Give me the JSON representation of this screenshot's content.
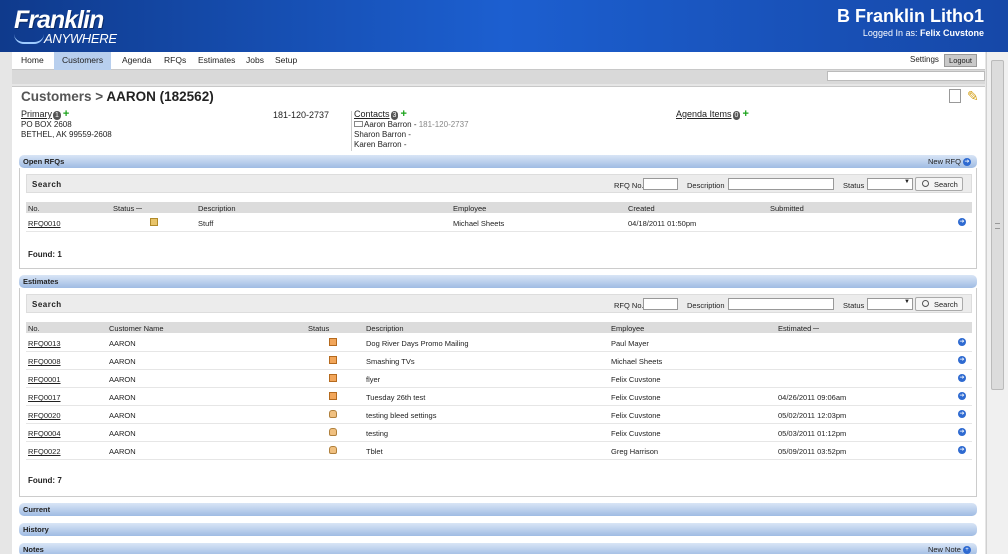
{
  "header": {
    "logo_main": "Franklin",
    "logo_sub": "ANYWHERE",
    "company": "B Franklin Litho1",
    "logged_prefix": "Logged In as:",
    "logged_user": "Felix Cuvstone"
  },
  "nav": {
    "items": [
      "Home",
      "Customers",
      "Agenda",
      "RFQs",
      "Estimates",
      "Jobs",
      "Setup"
    ],
    "settings": "Settings",
    "logout": "Logout"
  },
  "page": {
    "title_prefix": "Customers >",
    "title_name": "AARON (182562)"
  },
  "primary": {
    "label": "Primary",
    "count": "1",
    "address1": "PO BOX 2608",
    "address2": "BETHEL, AK 99559-2608",
    "phone": "181-120-2737"
  },
  "contacts": {
    "label": "Contacts",
    "count": "3",
    "items": [
      {
        "name": "Aaron Barron",
        "sep": " - ",
        "phone": "181-120-2737"
      },
      {
        "name": "Sharon Barron",
        "sep": " -",
        "phone": ""
      },
      {
        "name": "Karen Barron",
        "sep": " -",
        "phone": ""
      }
    ]
  },
  "agenda": {
    "label": "Agenda Items",
    "count": "0"
  },
  "open_rfqs": {
    "title": "Open RFQs",
    "new_link": "New RFQ",
    "search": {
      "label": "Search",
      "rfq_no_label": "RFQ No.",
      "desc_label": "Description",
      "status_label": "Status",
      "button": "Search"
    },
    "columns": [
      "No.",
      "Status",
      "Description",
      "Employee",
      "Created",
      "Submitted"
    ],
    "rows": [
      {
        "no": "RFQ0010",
        "status": "folder",
        "description": "Stuff",
        "employee": "Michael Sheets",
        "created": "04/18/2011 01:50pm",
        "submitted": ""
      }
    ],
    "found": "Found: 1"
  },
  "estimates": {
    "title": "Estimates",
    "search": {
      "label": "Search",
      "rfq_no_label": "RFQ No.",
      "desc_label": "Description",
      "status_label": "Status",
      "button": "Search"
    },
    "columns": [
      "No.",
      "Customer Name",
      "Status",
      "Description",
      "Employee",
      "Estimated"
    ],
    "rows": [
      {
        "no": "RFQ0013",
        "customer": "AARON",
        "status": "doc",
        "description": "Dog River Days Promo Mailing",
        "employee": "Paul Mayer",
        "estimated": ""
      },
      {
        "no": "RFQ0008",
        "customer": "AARON",
        "status": "doc",
        "description": "Smashing TVs",
        "employee": "Michael Sheets",
        "estimated": ""
      },
      {
        "no": "RFQ0001",
        "customer": "AARON",
        "status": "doc",
        "description": "flyer",
        "employee": "Felix Cuvstone",
        "estimated": ""
      },
      {
        "no": "RFQ0017",
        "customer": "AARON",
        "status": "doc",
        "description": "Tuesday 26th test",
        "employee": "Felix Cuvstone",
        "estimated": "04/26/2011 09:06am"
      },
      {
        "no": "RFQ0020",
        "customer": "AARON",
        "status": "thumb",
        "description": "testing bleed settings",
        "employee": "Felix Cuvstone",
        "estimated": "05/02/2011 12:03pm"
      },
      {
        "no": "RFQ0004",
        "customer": "AARON",
        "status": "thumb",
        "description": "testing",
        "employee": "Felix Cuvstone",
        "estimated": "05/03/2011 01:12pm"
      },
      {
        "no": "RFQ0022",
        "customer": "AARON",
        "status": "thumb",
        "description": "Tblet",
        "employee": "Greg Harrison",
        "estimated": "05/09/2011 03:52pm"
      }
    ],
    "found": "Found: 7"
  },
  "current": {
    "title": "Current"
  },
  "history": {
    "title": "History"
  },
  "notes": {
    "title": "Notes",
    "new_link": "New Note"
  },
  "colors": {
    "header": "#1c5fd0",
    "bar": "#9fbbe3",
    "active_nav": "#b8cfee",
    "plus": "#1aa31a"
  }
}
